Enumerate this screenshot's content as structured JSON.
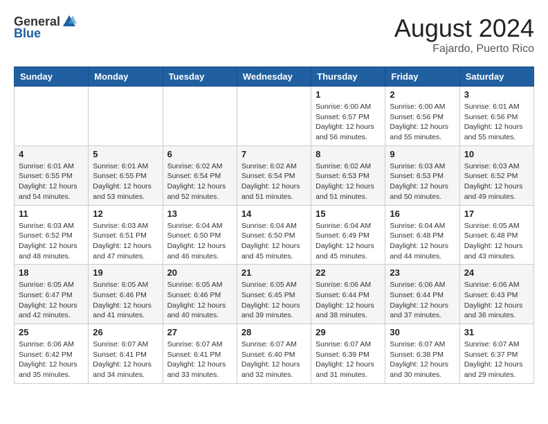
{
  "header": {
    "logo_general": "General",
    "logo_blue": "Blue",
    "month_year": "August 2024",
    "location": "Fajardo, Puerto Rico"
  },
  "weekdays": [
    "Sunday",
    "Monday",
    "Tuesday",
    "Wednesday",
    "Thursday",
    "Friday",
    "Saturday"
  ],
  "weeks": [
    [
      {
        "day": "",
        "detail": ""
      },
      {
        "day": "",
        "detail": ""
      },
      {
        "day": "",
        "detail": ""
      },
      {
        "day": "",
        "detail": ""
      },
      {
        "day": "1",
        "detail": "Sunrise: 6:00 AM\nSunset: 6:57 PM\nDaylight: 12 hours\nand 56 minutes."
      },
      {
        "day": "2",
        "detail": "Sunrise: 6:00 AM\nSunset: 6:56 PM\nDaylight: 12 hours\nand 55 minutes."
      },
      {
        "day": "3",
        "detail": "Sunrise: 6:01 AM\nSunset: 6:56 PM\nDaylight: 12 hours\nand 55 minutes."
      }
    ],
    [
      {
        "day": "4",
        "detail": "Sunrise: 6:01 AM\nSunset: 6:55 PM\nDaylight: 12 hours\nand 54 minutes."
      },
      {
        "day": "5",
        "detail": "Sunrise: 6:01 AM\nSunset: 6:55 PM\nDaylight: 12 hours\nand 53 minutes."
      },
      {
        "day": "6",
        "detail": "Sunrise: 6:02 AM\nSunset: 6:54 PM\nDaylight: 12 hours\nand 52 minutes."
      },
      {
        "day": "7",
        "detail": "Sunrise: 6:02 AM\nSunset: 6:54 PM\nDaylight: 12 hours\nand 51 minutes."
      },
      {
        "day": "8",
        "detail": "Sunrise: 6:02 AM\nSunset: 6:53 PM\nDaylight: 12 hours\nand 51 minutes."
      },
      {
        "day": "9",
        "detail": "Sunrise: 6:03 AM\nSunset: 6:53 PM\nDaylight: 12 hours\nand 50 minutes."
      },
      {
        "day": "10",
        "detail": "Sunrise: 6:03 AM\nSunset: 6:52 PM\nDaylight: 12 hours\nand 49 minutes."
      }
    ],
    [
      {
        "day": "11",
        "detail": "Sunrise: 6:03 AM\nSunset: 6:52 PM\nDaylight: 12 hours\nand 48 minutes."
      },
      {
        "day": "12",
        "detail": "Sunrise: 6:03 AM\nSunset: 6:51 PM\nDaylight: 12 hours\nand 47 minutes."
      },
      {
        "day": "13",
        "detail": "Sunrise: 6:04 AM\nSunset: 6:50 PM\nDaylight: 12 hours\nand 46 minutes."
      },
      {
        "day": "14",
        "detail": "Sunrise: 6:04 AM\nSunset: 6:50 PM\nDaylight: 12 hours\nand 45 minutes."
      },
      {
        "day": "15",
        "detail": "Sunrise: 6:04 AM\nSunset: 6:49 PM\nDaylight: 12 hours\nand 45 minutes."
      },
      {
        "day": "16",
        "detail": "Sunrise: 6:04 AM\nSunset: 6:48 PM\nDaylight: 12 hours\nand 44 minutes."
      },
      {
        "day": "17",
        "detail": "Sunrise: 6:05 AM\nSunset: 6:48 PM\nDaylight: 12 hours\nand 43 minutes."
      }
    ],
    [
      {
        "day": "18",
        "detail": "Sunrise: 6:05 AM\nSunset: 6:47 PM\nDaylight: 12 hours\nand 42 minutes."
      },
      {
        "day": "19",
        "detail": "Sunrise: 6:05 AM\nSunset: 6:46 PM\nDaylight: 12 hours\nand 41 minutes."
      },
      {
        "day": "20",
        "detail": "Sunrise: 6:05 AM\nSunset: 6:46 PM\nDaylight: 12 hours\nand 40 minutes."
      },
      {
        "day": "21",
        "detail": "Sunrise: 6:05 AM\nSunset: 6:45 PM\nDaylight: 12 hours\nand 39 minutes."
      },
      {
        "day": "22",
        "detail": "Sunrise: 6:06 AM\nSunset: 6:44 PM\nDaylight: 12 hours\nand 38 minutes."
      },
      {
        "day": "23",
        "detail": "Sunrise: 6:06 AM\nSunset: 6:44 PM\nDaylight: 12 hours\nand 37 minutes."
      },
      {
        "day": "24",
        "detail": "Sunrise: 6:06 AM\nSunset: 6:43 PM\nDaylight: 12 hours\nand 36 minutes."
      }
    ],
    [
      {
        "day": "25",
        "detail": "Sunrise: 6:06 AM\nSunset: 6:42 PM\nDaylight: 12 hours\nand 35 minutes."
      },
      {
        "day": "26",
        "detail": "Sunrise: 6:07 AM\nSunset: 6:41 PM\nDaylight: 12 hours\nand 34 minutes."
      },
      {
        "day": "27",
        "detail": "Sunrise: 6:07 AM\nSunset: 6:41 PM\nDaylight: 12 hours\nand 33 minutes."
      },
      {
        "day": "28",
        "detail": "Sunrise: 6:07 AM\nSunset: 6:40 PM\nDaylight: 12 hours\nand 32 minutes."
      },
      {
        "day": "29",
        "detail": "Sunrise: 6:07 AM\nSunset: 6:39 PM\nDaylight: 12 hours\nand 31 minutes."
      },
      {
        "day": "30",
        "detail": "Sunrise: 6:07 AM\nSunset: 6:38 PM\nDaylight: 12 hours\nand 30 minutes."
      },
      {
        "day": "31",
        "detail": "Sunrise: 6:07 AM\nSunset: 6:37 PM\nDaylight: 12 hours\nand 29 minutes."
      }
    ]
  ]
}
